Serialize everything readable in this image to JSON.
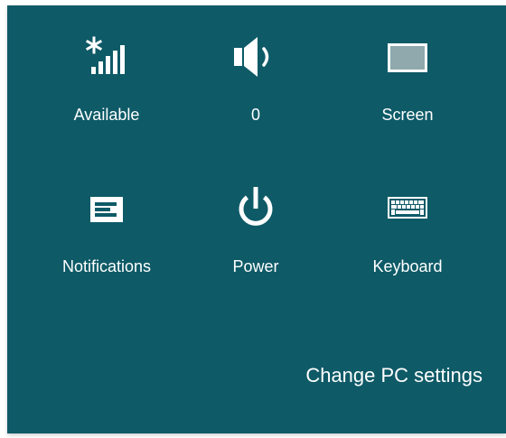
{
  "colors": {
    "panel_background": "#0e5a67",
    "text": "#ffffff",
    "screen_icon_fill": "#8fa9ad"
  },
  "quick_settings": [
    {
      "id": "network",
      "label": "Available",
      "icon": "network-signal-icon"
    },
    {
      "id": "volume",
      "label": "0",
      "icon": "speaker-volume-icon"
    },
    {
      "id": "screen",
      "label": "Screen",
      "icon": "screen-brightness-icon"
    },
    {
      "id": "notifications",
      "label": "Notifications",
      "icon": "notifications-icon"
    },
    {
      "id": "power",
      "label": "Power",
      "icon": "power-icon"
    },
    {
      "id": "keyboard",
      "label": "Keyboard",
      "icon": "keyboard-icon"
    }
  ],
  "footer": {
    "change_pc_settings_label": "Change PC settings"
  }
}
